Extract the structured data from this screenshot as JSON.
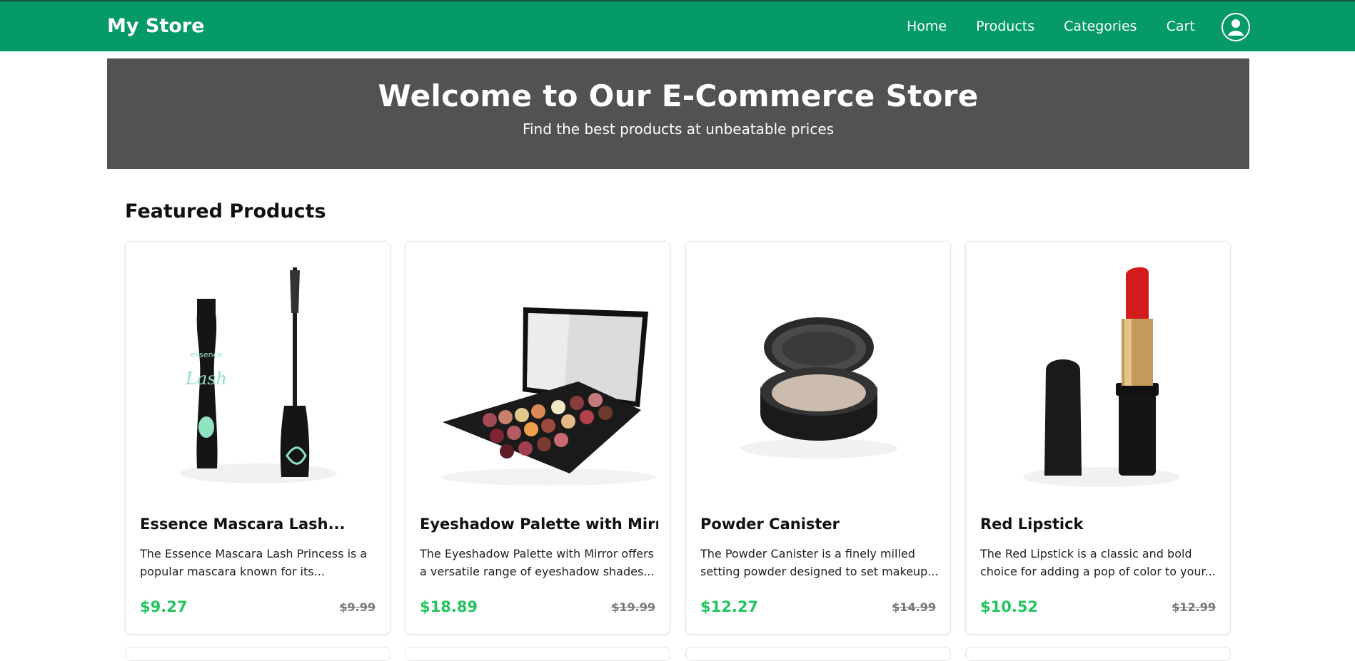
{
  "navbar": {
    "brand": "My Store",
    "links": [
      "Home",
      "Products",
      "Categories",
      "Cart"
    ],
    "profile_icon": "user-circle-icon",
    "color": "#06996a"
  },
  "hero": {
    "title": "Welcome to Our E-Commerce Store",
    "subtitle": "Find the best products at unbeatable prices",
    "background": "#525252"
  },
  "featured": {
    "title": "Featured Products",
    "products": [
      {
        "name": "Essence Mascara Lash...",
        "description": "The Essence Mascara Lash Princess is a popular mascara known for its...",
        "price": "$9.27",
        "original_price": "$9.99",
        "image": "mascara"
      },
      {
        "name": "Eyeshadow Palette with Mirror",
        "description": "The Eyeshadow Palette with Mirror offers a versatile range of eyeshadow shades...",
        "price": "$18.89",
        "original_price": "$19.99",
        "image": "eyeshadow-palette"
      },
      {
        "name": "Powder Canister",
        "description": "The Powder Canister is a finely milled setting powder designed to set makeup...",
        "price": "$12.27",
        "original_price": "$14.99",
        "image": "powder-canister"
      },
      {
        "name": "Red Lipstick",
        "description": "The Red Lipstick is a classic and bold choice for adding a pop of color to your...",
        "price": "$10.52",
        "original_price": "$12.99",
        "image": "red-lipstick"
      }
    ]
  },
  "colors": {
    "price": "#22c55e",
    "old_price": "#777777"
  }
}
